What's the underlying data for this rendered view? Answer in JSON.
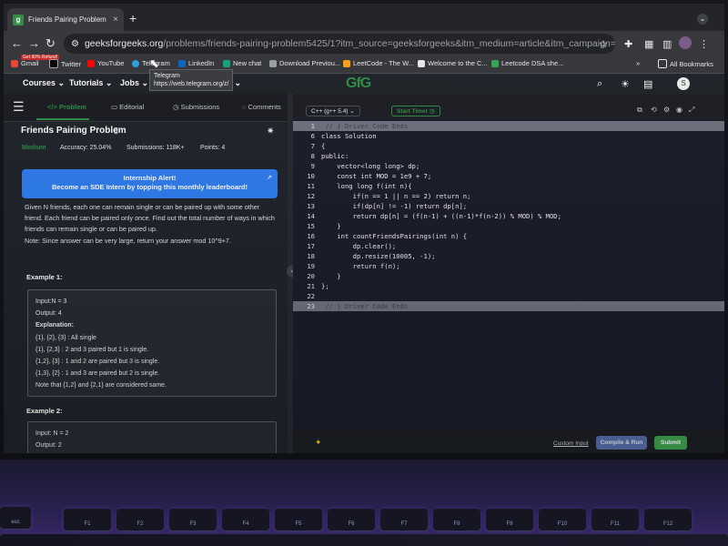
{
  "browser": {
    "tab_title": "Friends Pairing Problem | Prac",
    "tab_close": "×",
    "new_tab": "+",
    "url_domain": "geeksforgeeks.org",
    "url_path": "/problems/friends-pairing-problem5425/1?itm_source=geeksforgeeks&itm_medium=article&itm_campaign=bottom_sticky_on_article",
    "bookmarks": [
      "Gmail",
      "Twitter",
      "YouTube",
      "Telegram",
      "LinkedIn",
      "New chat",
      "Download Previou...",
      "LeetCode - The W...",
      "Welcome to the C...",
      "Leetcode DSA she..."
    ],
    "bookmark_badge": "Get 90% Refund!",
    "all_bookmarks": "All Bookmarks",
    "more_bookmarks": "»",
    "tooltip_line1": "Telegram",
    "tooltip_line2": "https://web.telegram.org/z/"
  },
  "site_header": {
    "courses": "Courses",
    "tutorials": "Tutorials",
    "jobs": "Jobs",
    "jobs_suffix": "ts",
    "logo": "GfG"
  },
  "problem_tabs": {
    "problem": "Problem",
    "editorial": "Editorial",
    "submissions": "Submissions",
    "comments": "Comments"
  },
  "problem": {
    "title": "Friends Pairing Problem",
    "difficulty": "Medium",
    "accuracy": "Accuracy: 25.04%",
    "submissions": "Submissions: 118K+",
    "points": "Points: 4",
    "alert_line1": "Internship Alert!",
    "alert_line2": "Become an SDE Intern by topping this monthly leaderboard!",
    "description_1": "Given N friends, each one can remain single or can be paired up with some other friend. Each friend can be paired only once. Find out the total number of ways in which friends can remain single or can be paired up.",
    "description_2": "Note: Since answer can be very large, return your answer mod 10^9+7.",
    "example1_title": "Example 1:",
    "example1_lines": [
      "Input:N = 3",
      "Output: 4",
      "Explanation:",
      "{1}, {2}, {3} : All single",
      "{1}, {2,3} : 2 and 3 paired but 1 is single.",
      "{1,2}, {3} : 1 and 2 are paired but 3 is single.",
      "{1,3}, {2} : 1 and 3 are paired but 2 is single.",
      "Note that {1,2} and {2,1} are considered same."
    ],
    "example2_title": "Example 2:",
    "example2_lines": [
      "Input:  N = 2",
      "Output:  2"
    ]
  },
  "editor": {
    "language": "C++ (g++ 5.4)",
    "timer": "Start Timer",
    "line_numbers": [
      "1",
      "6",
      "7",
      "8",
      "9",
      "10",
      "11",
      "12",
      "13",
      "14",
      "15",
      "16",
      "17",
      "18",
      "19",
      "20",
      "21",
      "22",
      "23"
    ],
    "code_lines": [
      " // } Driver Code Ends",
      "class Solution",
      "{",
      "public:",
      "    vector<long long> dp;",
      "    const int MOD = 1e9 + 7;",
      "    long long f(int n){",
      "        if(n == 1 || n == 2) return n;",
      "        if(dp[n] != -1) return dp[n];",
      "        return dp[n] = (f(n-1) + ((n-1)*f(n-2)) % MOD) % MOD;",
      "    }",
      "    int countFriendsPairings(int n) {",
      "        dp.clear();",
      "        dp.resize(10005, -1);",
      "        return f(n);",
      "    }",
      "};",
      "",
      " // } Driver Code Ends"
    ],
    "custom_input": "Custom Input",
    "compile_run": "Compile & Run",
    "submit": "Submit"
  },
  "keyboard": {
    "keys": [
      "esc",
      "F1",
      "F2",
      "F3",
      "F4",
      "F5",
      "F6",
      "F7",
      "F8",
      "F9",
      "F10",
      "F11",
      "F12"
    ]
  }
}
